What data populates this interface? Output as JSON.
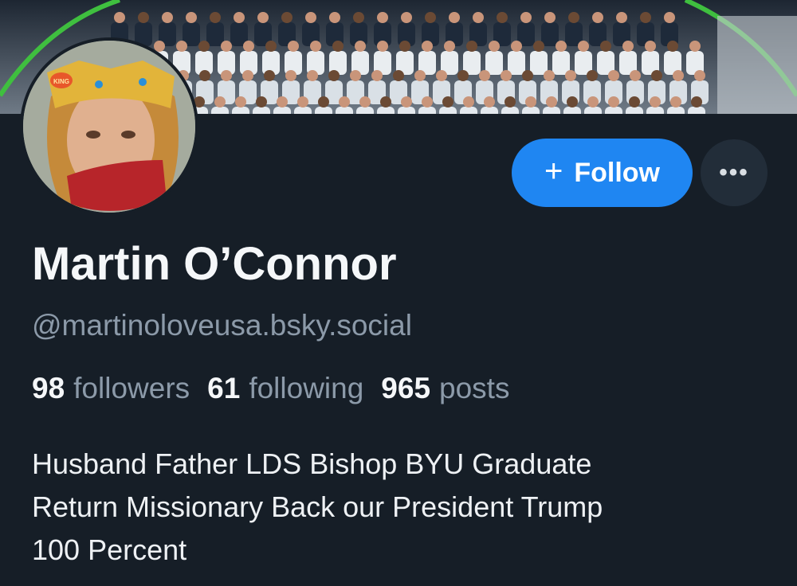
{
  "profile": {
    "display_name": "Martin O’Connor",
    "handle": "@martinoloveusa.bsky.social",
    "stats": {
      "followers_count": "98",
      "followers_label": "followers",
      "following_count": "61",
      "following_label": "following",
      "posts_count": "965",
      "posts_label": "posts"
    },
    "bio_lines": [
      "Husband Father LDS Bishop BYU Graduate",
      "Return Missionary Back our President Trump",
      "100 Percent"
    ]
  },
  "actions": {
    "follow_label": "Follow",
    "more_label": "•••"
  },
  "icons": {
    "follow_icon": "plus-icon",
    "more_icon": "ellipsis-icon",
    "crown_badge_text": "KING"
  },
  "colors": {
    "background": "#161e27",
    "accent": "#1f86f2",
    "muted_text": "#8c9aa9"
  }
}
